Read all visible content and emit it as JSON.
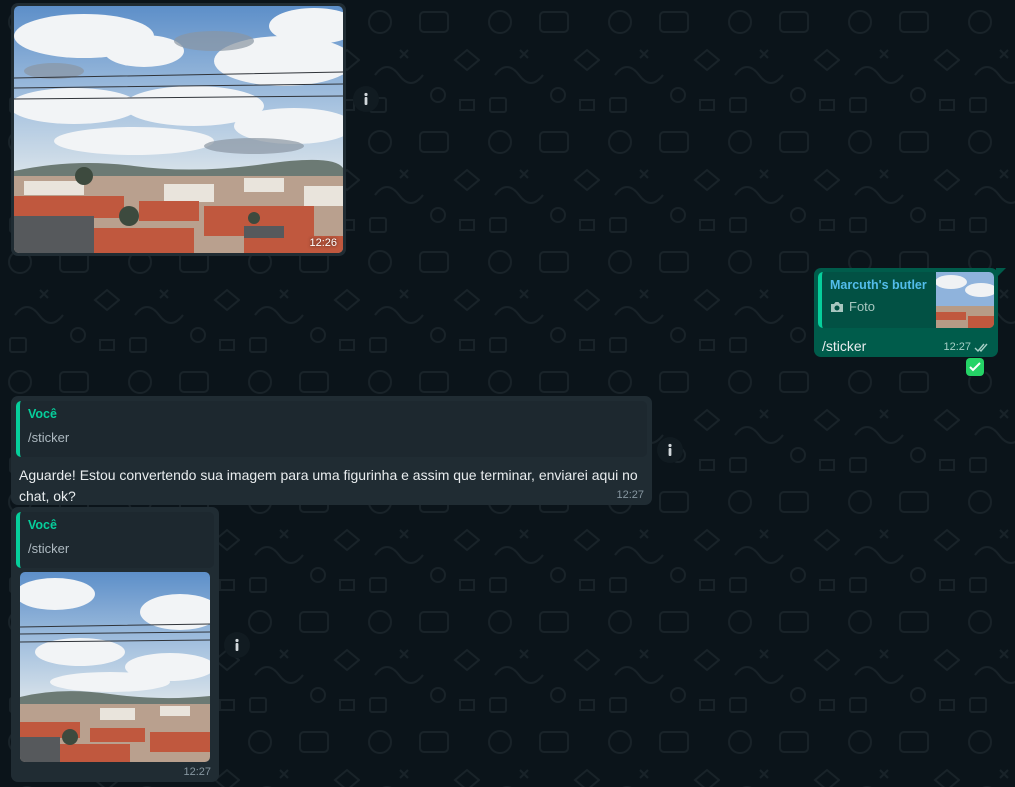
{
  "colors": {
    "background": "#0b141a",
    "incoming_bubble": "#202c33",
    "outgoing_bubble": "#005c4b",
    "quote_accent": "#06cf9c",
    "quote_name_outgoing": "#53bdeb",
    "checkmark": "#25d366"
  },
  "messages": [
    {
      "direction": "incoming",
      "type": "image",
      "time": "12:26"
    },
    {
      "direction": "outgoing",
      "quote": {
        "name": "Marcuth's butler",
        "label": "Foto",
        "icon": "camera-icon"
      },
      "text": "/sticker",
      "time": "12:27",
      "status": "read-double-check"
    },
    {
      "direction": "incoming",
      "quote": {
        "name": "Você",
        "text": "/sticker"
      },
      "text": "Aguarde! Estou convertendo sua imagem para uma figurinha e assim que terminar, enviarei aqui no chat, ok?",
      "time": "12:27"
    },
    {
      "direction": "incoming",
      "quote": {
        "name": "Você",
        "text": "/sticker"
      },
      "type": "image",
      "time": "12:27"
    }
  ]
}
